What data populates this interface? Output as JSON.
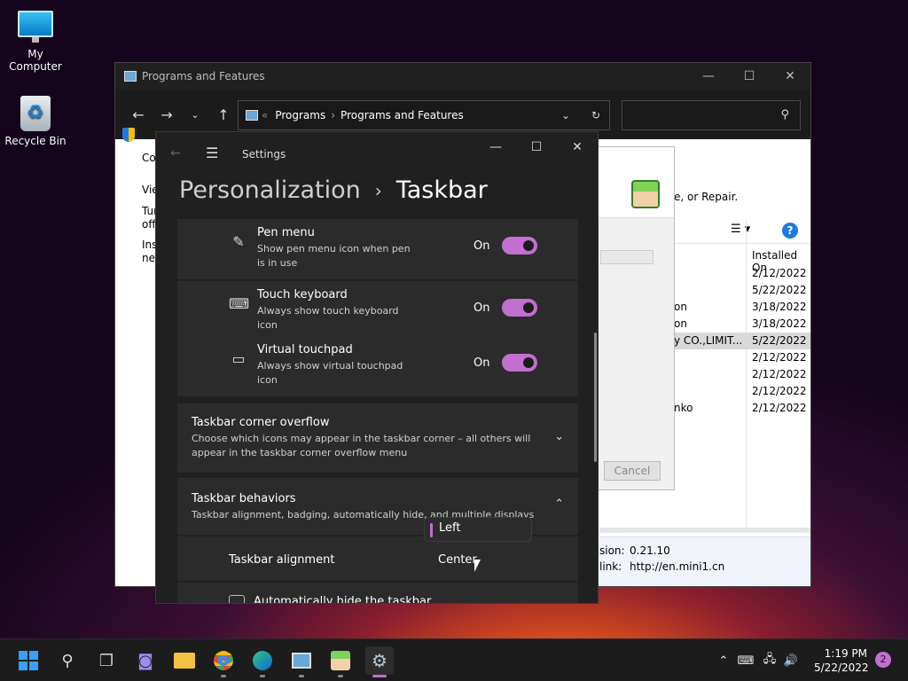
{
  "desktop": {
    "icons": [
      {
        "label": "My Computer"
      },
      {
        "label": "Recycle Bin"
      }
    ]
  },
  "programs": {
    "title": "Programs and Features",
    "address": {
      "part1": "Programs",
      "part2": "Programs and Features"
    },
    "left": {
      "l1": "Co",
      "l2": "Vie",
      "l3": "Tur",
      "l4": "off",
      "l5": "Inst",
      "l6": "net"
    },
    "header_text": "e, or Repair.",
    "col_header": "Installed On",
    "rows": [
      {
        "name": "",
        "date": "2/12/2022"
      },
      {
        "name": "",
        "date": "5/22/2022"
      },
      {
        "name": "on",
        "date": "3/18/2022"
      },
      {
        "name": "on",
        "date": "3/18/2022"
      },
      {
        "name": "y CO.,LIMIT...",
        "date": "5/22/2022"
      },
      {
        "name": "",
        "date": "2/12/2022"
      },
      {
        "name": "",
        "date": "2/12/2022"
      },
      {
        "name": "",
        "date": "2/12/2022"
      },
      {
        "name": "nko",
        "date": "2/12/2022"
      }
    ],
    "footer": {
      "k1": "sion:",
      "v1": "0.21.10",
      "k2": "link:",
      "v2": "http://en.mini1.cn"
    },
    "dialog_cancel": "Cancel"
  },
  "settings": {
    "title": "Settings",
    "breadcrumb": {
      "parent": "Personalization",
      "current": "Taskbar"
    },
    "rows": [
      {
        "title": "Pen menu",
        "desc": "Show pen menu icon when pen is in use",
        "state": "On"
      },
      {
        "title": "Touch keyboard",
        "desc": "Always show touch keyboard icon",
        "state": "On"
      },
      {
        "title": "Virtual touchpad",
        "desc": "Always show virtual touchpad icon",
        "state": "On"
      }
    ],
    "corner_overflow": {
      "title": "Taskbar corner overflow",
      "desc": "Choose which icons may appear in the taskbar corner – all others will appear in the taskbar corner overflow menu"
    },
    "behaviors": {
      "title": "Taskbar behaviors",
      "desc": "Taskbar alignment, badging, automatically hide, and multiple displays"
    },
    "alignment": {
      "label": "Taskbar alignment",
      "options": [
        "Left",
        "Center"
      ],
      "hovered": "Center"
    },
    "autohide": "Automatically hide the taskbar"
  },
  "taskbar": {
    "time": "1:19 PM",
    "date": "5/22/2022",
    "notifications": "2"
  },
  "colors": {
    "accent": "#c36ed1"
  }
}
